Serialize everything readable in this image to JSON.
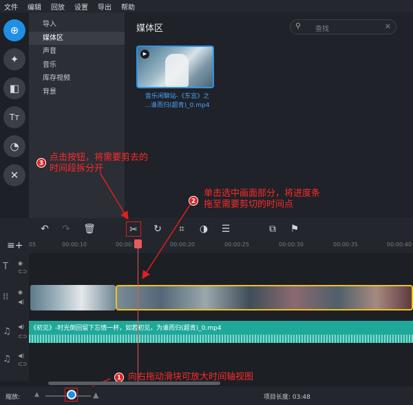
{
  "menu": [
    "文件",
    "编辑",
    "回放",
    "设置",
    "导出",
    "帮助"
  ],
  "sidebar_icons": [
    {
      "name": "import-icon",
      "glyph": "⊞",
      "active": true
    },
    {
      "name": "magic-wand-icon",
      "glyph": "✦"
    },
    {
      "name": "transitions-icon",
      "glyph": "◧"
    },
    {
      "name": "titles-icon",
      "glyph": "Tт"
    },
    {
      "name": "filters-icon",
      "glyph": "◔"
    },
    {
      "name": "tools-icon",
      "glyph": "✕"
    }
  ],
  "nav": [
    "导入",
    "媒体区",
    "声音",
    "音乐",
    "库存视频",
    "背景"
  ],
  "nav_active": "媒体区",
  "media": {
    "title": "媒体区",
    "search_placeholder": "查找",
    "clip_name_line1": "音乐闲聊站-《东宫》之",
    "clip_name_line2": "...谁而归(超青)_0.mp4"
  },
  "annotations": {
    "a3_number": "3",
    "a3_line1": "点击按钮，将需要剪去的",
    "a3_line2": "时间段拆分开",
    "a2_number": "2",
    "a2_line1": "单击选中画面部分，将进度条",
    "a2_line2": "拖至需要剪切的时间点",
    "a1_number": "1",
    "a1_text": "向右拖动滑块可放大时间轴视图"
  },
  "ruler_ticks": [
    "00:00:10",
    "00:00:15",
    "00:00:20",
    "00:00:25",
    "00:00:30",
    "00:00:35",
    "00:00:40"
  ],
  "ruler_first": "05",
  "audio_label": "《初见》-时光倒回留下忘情一杯，如若初见，为谁而归(超青)_0.mp4",
  "footer": {
    "zoom_label": "缩放:",
    "project_length": "项目长度:  03:48"
  },
  "colors": {
    "accent": "#1f8fe4",
    "annotation": "#ff2a2a",
    "audio": "#1fa89a",
    "selection": "#f3c21b"
  }
}
